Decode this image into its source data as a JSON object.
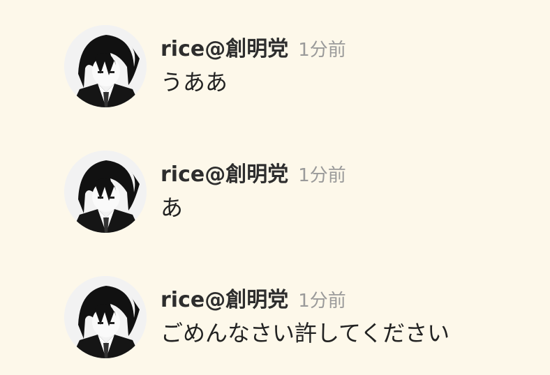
{
  "messages": [
    {
      "username": "rice@創明党",
      "time": "1分前",
      "text": "うああ",
      "avatar_icon": "anime-avatar-icon"
    },
    {
      "username": "rice@創明党",
      "time": "1分前",
      "text": "あ",
      "avatar_icon": "anime-avatar-icon"
    },
    {
      "username": "rice@創明党",
      "time": "1分前",
      "text": "ごめんなさい許してください",
      "avatar_icon": "anime-avatar-icon"
    }
  ],
  "colors": {
    "background": "#fdf8ea",
    "username": "#2d2d2d",
    "timestamp": "#9a9a9a",
    "text": "#222222"
  }
}
